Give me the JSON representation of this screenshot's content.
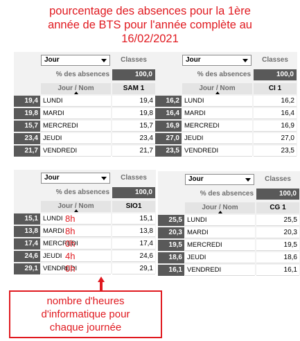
{
  "title": {
    "line1": "pourcentage des absences pour la 1ère",
    "line2": "année de BTS pour l'année complète au",
    "line3": "16/02/2021"
  },
  "colors": {
    "annotation": "#e0191f",
    "row_value_bg": "#595959",
    "header_bg": "#e4e4e4",
    "panel_bg": "#f2f2f2"
  },
  "icons": {
    "dropdown": "chevron-down-icon",
    "sort": "sort-arrow-icon"
  },
  "tables": [
    {
      "dropdown": "Jour",
      "classes_label": "Classes",
      "pct_label": "% des absences",
      "pct_value": "100,0",
      "col_header": "Jour / Nom",
      "class_name": "SAM 1",
      "rows": [
        {
          "value": "19,4",
          "day": "LUNDI",
          "class_value": "19,4",
          "hours": ""
        },
        {
          "value": "19,8",
          "day": "MARDI",
          "class_value": "19,8",
          "hours": ""
        },
        {
          "value": "15,7",
          "day": "MERCREDI",
          "class_value": "15,7",
          "hours": ""
        },
        {
          "value": "23,4",
          "day": "JEUDI",
          "class_value": "23,4",
          "hours": ""
        },
        {
          "value": "21,7",
          "day": "VENDREDI",
          "class_value": "21,7",
          "hours": ""
        }
      ]
    },
    {
      "dropdown": "Jour",
      "classes_label": "Classes",
      "pct_label": "% des absences",
      "pct_value": "100,0",
      "col_header": "Jour / Nom",
      "class_name": "CI 1",
      "rows": [
        {
          "value": "16,2",
          "day": "LUNDI",
          "class_value": "16,2",
          "hours": ""
        },
        {
          "value": "16,4",
          "day": "MARDI",
          "class_value": "16,4",
          "hours": ""
        },
        {
          "value": "16,9",
          "day": "MERCREDI",
          "class_value": "16,9",
          "hours": ""
        },
        {
          "value": "27,0",
          "day": "JEUDI",
          "class_value": "27,0",
          "hours": ""
        },
        {
          "value": "23,5",
          "day": "VENDREDI",
          "class_value": "23,5",
          "hours": ""
        }
      ]
    },
    {
      "dropdown": "Jour",
      "classes_label": "Classes",
      "pct_label": "% des absences",
      "pct_value": "100,0",
      "col_header": "Jour / Nom",
      "class_name": "SIO1",
      "rows": [
        {
          "value": "15,1",
          "day": "LUNDI",
          "class_value": "15,1",
          "hours": "8h"
        },
        {
          "value": "13,8",
          "day": "MARDI",
          "class_value": "13,8",
          "hours": "8h"
        },
        {
          "value": "17,4",
          "day": "MERCREDI",
          "class_value": "17,4",
          "hours": "0h"
        },
        {
          "value": "24,6",
          "day": "JEUDI",
          "class_value": "24,6",
          "hours": "4h"
        },
        {
          "value": "29,1",
          "day": "VENDREDI",
          "class_value": "29,1",
          "hours": "0h"
        }
      ]
    },
    {
      "dropdown": "Jour",
      "classes_label": "Classes",
      "pct_label": "% des absences",
      "pct_value": "100,0",
      "col_header": "Jour / Nom",
      "class_name": "CG 1",
      "rows": [
        {
          "value": "25,5",
          "day": "LUNDI",
          "class_value": "25,5",
          "hours": ""
        },
        {
          "value": "20,3",
          "day": "MARDI",
          "class_value": "20,3",
          "hours": ""
        },
        {
          "value": "19,5",
          "day": "MERCREDI",
          "class_value": "19,5",
          "hours": ""
        },
        {
          "value": "18,6",
          "day": "JEUDI",
          "class_value": "18,6",
          "hours": ""
        },
        {
          "value": "16,1",
          "day": "VENDREDI",
          "class_value": "16,1",
          "hours": ""
        }
      ]
    }
  ],
  "annotation": {
    "line1": "nombre d'heures",
    "line2": "d'informatique pour",
    "line3": "chaque journée"
  }
}
